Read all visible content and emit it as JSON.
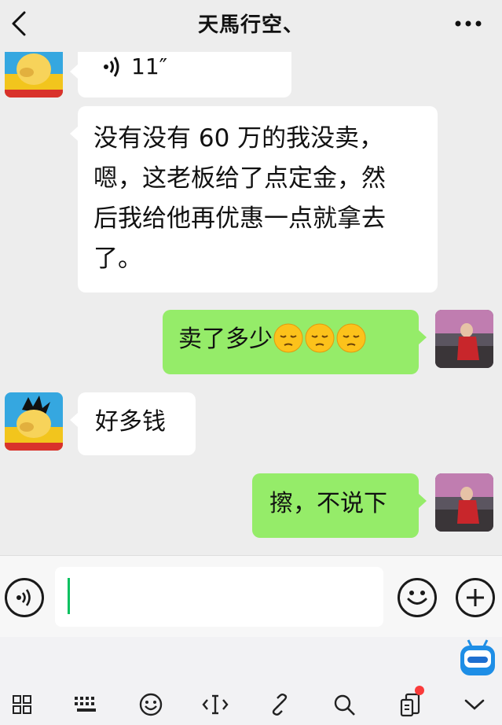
{
  "header": {
    "title": "天馬行空、"
  },
  "messages": [
    {
      "side": "left",
      "type": "voice",
      "duration": "11″"
    },
    {
      "side": "left",
      "type": "text",
      "lines": [
        "没有没有 60 万的我没卖，",
        "嗯，这老板给了点定金，然",
        "后我给他再优惠一点就拿去",
        "了。"
      ]
    },
    {
      "side": "right",
      "type": "text",
      "text": "卖了多少",
      "emoji": [
        "pensive-face",
        "pensive-face",
        "pensive-face"
      ]
    },
    {
      "side": "left",
      "type": "text",
      "text": "好多钱"
    },
    {
      "side": "right",
      "type": "text",
      "text": "擦，不说下"
    }
  ],
  "inputbar": {
    "value": "",
    "icons": [
      "voice-icon",
      "emoji-icon",
      "plus-icon"
    ]
  },
  "toolbar": {
    "icons": [
      "grid-icon",
      "keyboard-icon",
      "smiley-icon",
      "cursor-icon",
      "link-icon",
      "search-icon",
      "clipboard-icon",
      "chevron-down-icon"
    ],
    "badge_color": "#fa3b3b"
  },
  "colors": {
    "sent_bubble": "#95ec69",
    "received_bubble": "#ffffff",
    "caret": "#07c160",
    "background": "#ededed"
  }
}
